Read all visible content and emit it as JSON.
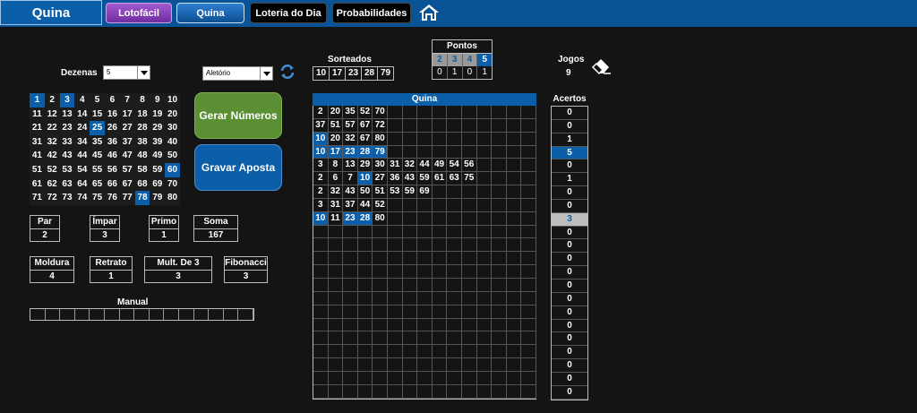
{
  "app": {
    "title": "Quina"
  },
  "nav": {
    "lotofacil": "Lotofácil",
    "quina": "Quina",
    "loteria": "Loteria do Dia",
    "probabilidades": "Probabilidades"
  },
  "controls": {
    "dezenas_label": "Dezenas",
    "dezenas_value": "5",
    "mode_value": "Aletório"
  },
  "numbers": {
    "selected": [
      1,
      3,
      25,
      60,
      78
    ]
  },
  "buttons": {
    "gerar": "Gerar Números",
    "gravar": "Gravar Aposta"
  },
  "stats": {
    "par": {
      "label": "Par",
      "value": "2"
    },
    "impar": {
      "label": "Ímpar",
      "value": "3"
    },
    "primo": {
      "label": "Primo",
      "value": "1"
    },
    "soma": {
      "label": "Soma",
      "value": "167"
    },
    "moldura": {
      "label": "Moldura",
      "value": "4"
    },
    "retrato": {
      "label": "Retrato",
      "value": "1"
    },
    "mult3": {
      "label": "Mult. De 3",
      "value": "3"
    },
    "fibonacci": {
      "label": "Fibonacci",
      "value": "3"
    }
  },
  "manual": {
    "label": "Manual"
  },
  "sorteados": {
    "label": "Sorteados",
    "values": [
      "10",
      "17",
      "23",
      "28",
      "79"
    ]
  },
  "pontos": {
    "label": "Pontos",
    "keys": [
      "2",
      "3",
      "4",
      "5"
    ],
    "values": [
      "0",
      "1",
      "0",
      "1"
    ],
    "highlight": "5"
  },
  "jogos": {
    "label": "Jogos",
    "value": "9"
  },
  "quina_table": {
    "title": "Quina",
    "rows": [
      {
        "nums": [
          "2",
          "20",
          "35",
          "52",
          "70"
        ],
        "hl": []
      },
      {
        "nums": [
          "37",
          "51",
          "57",
          "67",
          "72"
        ],
        "hl": []
      },
      {
        "nums": [
          "10",
          "20",
          "32",
          "67",
          "80"
        ],
        "hl": [
          "10"
        ]
      },
      {
        "nums": [
          "10",
          "17",
          "23",
          "28",
          "79"
        ],
        "hl": [
          "10",
          "17",
          "23",
          "28",
          "79"
        ]
      },
      {
        "nums": [
          "3",
          "8",
          "13",
          "29",
          "30",
          "31",
          "32",
          "44",
          "49",
          "54",
          "56"
        ],
        "hl": []
      },
      {
        "nums": [
          "2",
          "6",
          "7",
          "10",
          "27",
          "36",
          "43",
          "59",
          "61",
          "63",
          "75"
        ],
        "hl": [
          "10"
        ]
      },
      {
        "nums": [
          "2",
          "32",
          "43",
          "50",
          "51",
          "53",
          "59",
          "69"
        ],
        "hl": []
      },
      {
        "nums": [
          "3",
          "31",
          "37",
          "44",
          "52"
        ],
        "hl": []
      },
      {
        "nums": [
          "10",
          "11",
          "23",
          "28",
          "80"
        ],
        "hl": [
          "10",
          "23",
          "28"
        ]
      }
    ]
  },
  "acertos": {
    "label": "Acertos",
    "values": [
      "0",
      "0",
      "1",
      "5",
      "0",
      "1",
      "0",
      "0",
      "3",
      "0",
      "0",
      "0",
      "0",
      "0",
      "0",
      "0",
      "0",
      "0",
      "0",
      "0",
      "0",
      "0"
    ],
    "highlight_blue": [
      3
    ],
    "highlight_gray": [
      8
    ]
  },
  "colors": {
    "accent": "#0b5ea8",
    "topbar": "#0a5396",
    "green": "#5b8f34",
    "purple": "#8e44c0",
    "background": "#141414"
  }
}
